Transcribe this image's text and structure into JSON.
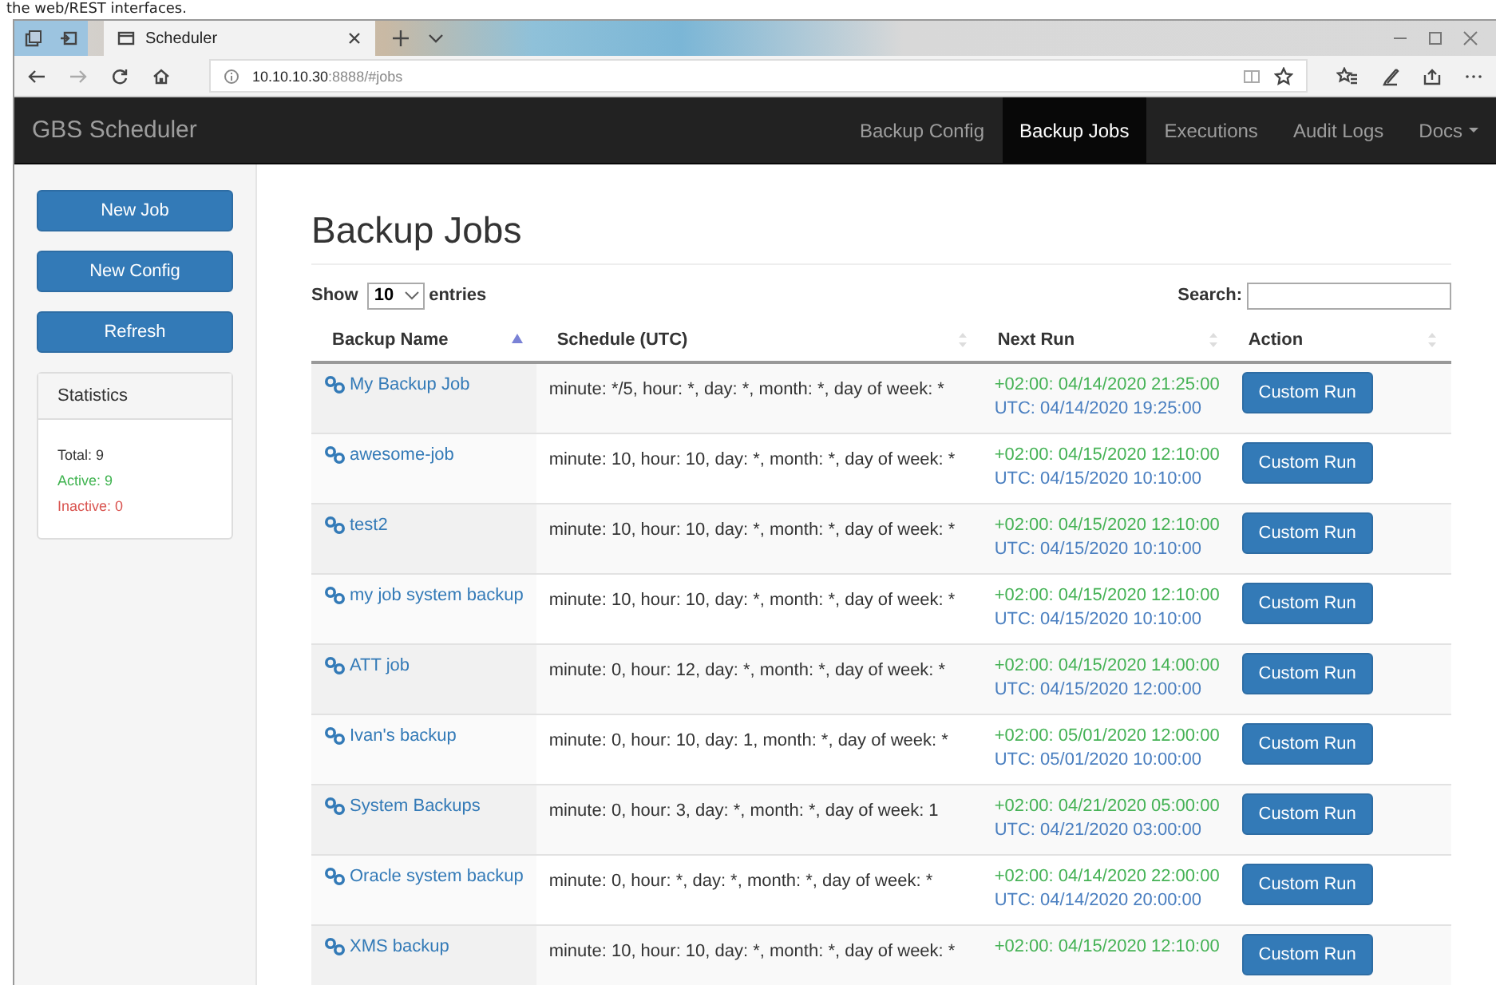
{
  "caption": "the web/REST interfaces.",
  "browser": {
    "tab_title": "Scheduler",
    "url": "**10.10.10.30**:8888/#jobs"
  },
  "navbar": {
    "brand": "GBS Scheduler",
    "items": [
      {
        "label": "Backup Config",
        "selected": false,
        "dropdown": false
      },
      {
        "label": "Backup Jobs",
        "selected": true,
        "dropdown": false
      },
      {
        "label": "Executions",
        "selected": false,
        "dropdown": false
      },
      {
        "label": "Audit Logs",
        "selected": false,
        "dropdown": false
      },
      {
        "label": "Docs",
        "selected": false,
        "dropdown": true
      }
    ]
  },
  "sidebar": {
    "buttons": [
      "New Job",
      "New Config",
      "Refresh"
    ],
    "statistics": {
      "title": "Statistics",
      "lines": [
        {
          "text": "Total: 9",
          "kind": "total"
        },
        {
          "text": "Active: 9",
          "kind": "active"
        },
        {
          "text": "Inactive: 0",
          "kind": "inactive"
        }
      ]
    }
  },
  "main": {
    "title": "Backup Jobs",
    "length": {
      "show": "Show",
      "value": "10",
      "entries": "entries"
    },
    "search": {
      "label": "Search:"
    },
    "table": {
      "columns": [
        {
          "label": "Backup Name",
          "sorted": true
        },
        {
          "label": "Schedule (UTC)",
          "sorted": false
        },
        {
          "label": "Next Run",
          "sorted": false
        },
        {
          "label": "Action",
          "sorted": false
        }
      ],
      "rows": [
        {
          "name": "My Backup Job",
          "schedule": "minute: */5, hour: *, day: *, month: *, day of week: *",
          "local": "+02:00: 04/14/2020 21:25:00",
          "utc": "UTC: 04/14/2020 19:25:00",
          "action": "Custom Run"
        },
        {
          "name": "awesome-job",
          "schedule": "minute: 10, hour: 10, day: *, month: *, day of week: *",
          "local": "+02:00: 04/15/2020 12:10:00",
          "utc": "UTC: 04/15/2020 10:10:00",
          "action": "Custom Run"
        },
        {
          "name": "test2",
          "schedule": "minute: 10, hour: 10, day: *, month: *, day of week: *",
          "local": "+02:00: 04/15/2020 12:10:00",
          "utc": "UTC: 04/15/2020 10:10:00",
          "action": "Custom Run"
        },
        {
          "name": "my job system backup",
          "schedule": "minute: 10, hour: 10, day: *, month: *, day of week: *",
          "local": "+02:00: 04/15/2020 12:10:00",
          "utc": "UTC: 04/15/2020 10:10:00",
          "action": "Custom Run"
        },
        {
          "name": "ATT job",
          "schedule": "minute: 0, hour: 12, day: *, month: *, day of week: *",
          "local": "+02:00: 04/15/2020 14:00:00",
          "utc": "UTC: 04/15/2020 12:00:00",
          "action": "Custom Run"
        },
        {
          "name": "Ivan's backup",
          "schedule": "minute: 0, hour: 10, day: 1, month: *, day of week: *",
          "local": "+02:00: 05/01/2020 12:00:00",
          "utc": "UTC: 05/01/2020 10:00:00",
          "action": "Custom Run"
        },
        {
          "name": "System Backups",
          "schedule": "minute: 0, hour: 3, day: *, month: *, day of week: 1",
          "local": "+02:00: 04/21/2020 05:00:00",
          "utc": "UTC: 04/21/2020 03:00:00",
          "action": "Custom Run"
        },
        {
          "name": "Oracle system backup",
          "schedule": "minute: 0, hour: *, day: *, month: *, day of week: *",
          "local": "+02:00: 04/14/2020 22:00:00",
          "utc": "UTC: 04/14/2020 20:00:00",
          "action": "Custom Run"
        },
        {
          "name": "XMS backup",
          "schedule": "minute: 10, hour: 10, day: *, month: *, day of week: *",
          "local": "+02:00: 04/15/2020 12:10:00",
          "action": "Custom Run"
        }
      ]
    }
  }
}
